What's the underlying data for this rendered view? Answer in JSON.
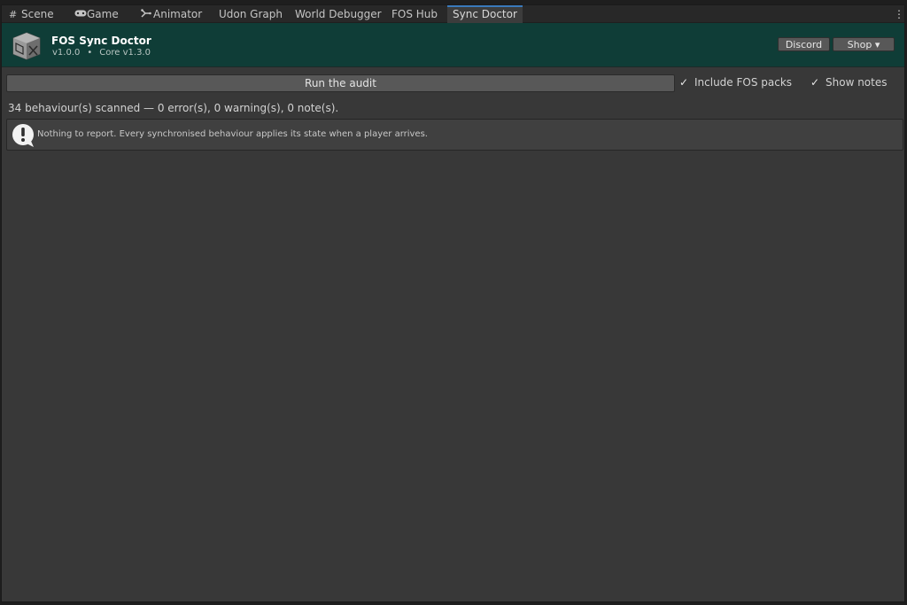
{
  "tabs": [
    {
      "label": "Scene",
      "icon": "grid-icon"
    },
    {
      "label": "Game",
      "icon": "gamepad-icon"
    },
    {
      "label": "Animator",
      "icon": "animator-icon"
    },
    {
      "label": "Udon Graph"
    },
    {
      "label": "World Debugger"
    },
    {
      "label": "FOS Hub"
    },
    {
      "label": "Sync Doctor",
      "active": true
    }
  ],
  "header": {
    "title": "FOS Sync Doctor",
    "version": "v1.0.0",
    "separator": "•",
    "core": "Core v1.3.0",
    "discord_label": "Discord",
    "shop_label": "Shop ▾",
    "background": "#0f3d37"
  },
  "controls": {
    "run_label": "Run the audit",
    "include_fos_packs": {
      "label": "Include FOS packs",
      "checked": true
    },
    "show_notes": {
      "label": "Show notes",
      "checked": true
    }
  },
  "summary": "34 behaviour(s) scanned — 0 error(s), 0 warning(s), 0 note(s).",
  "info": {
    "icon": "info-speech-icon",
    "text": "Nothing to report. Every synchronised behaviour applies its state when a player arrives."
  },
  "colors": {
    "panel": "#383838",
    "tab_accent": "#3a79bb",
    "button": "#585858"
  }
}
